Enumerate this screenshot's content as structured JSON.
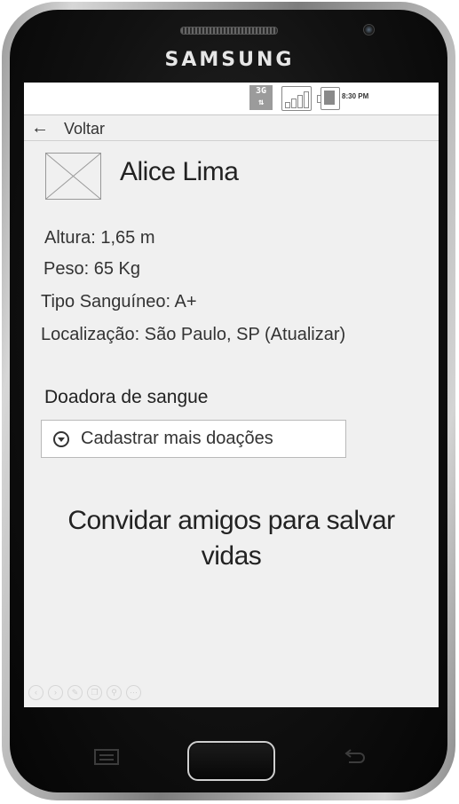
{
  "device": {
    "brand": "SAMSUNG"
  },
  "status_bar": {
    "network_label": "3G",
    "time": "8:30 PM"
  },
  "nav": {
    "back_label": "Voltar"
  },
  "profile": {
    "name": "Alice Lima",
    "height": "Altura: 1,65 m",
    "weight": "Peso: 65 Kg",
    "blood_type": "Tipo Sanguíneo: A+",
    "location": "Localização: São Paulo, SP (Atualizar)"
  },
  "donor": {
    "title": "Doadora de sangue",
    "register_button": "Cadastrar mais doações"
  },
  "invite": {
    "label": "Convidar amigos para salvar vidas"
  },
  "toolbar_icons": [
    "back-icon",
    "forward-icon",
    "edit-icon",
    "copy-icon",
    "zoom-icon",
    "more-icon"
  ]
}
